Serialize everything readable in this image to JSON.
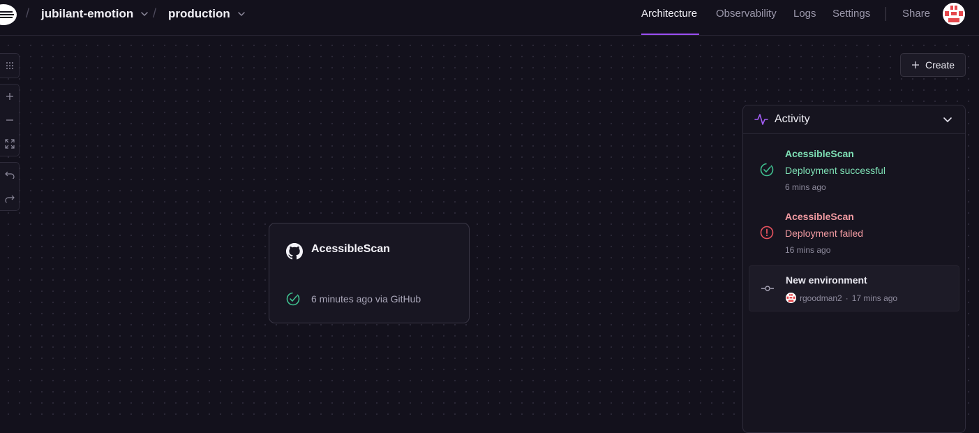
{
  "header": {
    "project": "jubilant-emotion",
    "environment": "production",
    "separator": "/",
    "nav": [
      "Architecture",
      "Observability",
      "Logs",
      "Settings"
    ],
    "active_nav": "Architecture",
    "share_label": "Share"
  },
  "toolbar": {
    "create_label": "Create"
  },
  "service_card": {
    "name": "AcessibleScan",
    "status": "6 minutes ago via GitHub"
  },
  "activity": {
    "title": "Activity",
    "items": [
      {
        "service": "AcessibleScan",
        "message": "Deployment successful",
        "time": "6 mins ago",
        "status": "success"
      },
      {
        "service": "AcessibleScan",
        "message": "Deployment failed",
        "time": "16 mins ago",
        "status": "failed"
      }
    ],
    "environment_event": {
      "title": "New environment",
      "user": "rgoodman2",
      "separator": "·",
      "time": "17 mins ago"
    }
  },
  "colors": {
    "accent": "#9b4ff2",
    "success": "#3fbf8f",
    "success_text": "#7ee0b5",
    "failed": "#e8535f",
    "failed_text": "#f19aa1",
    "background": "#13111c"
  }
}
